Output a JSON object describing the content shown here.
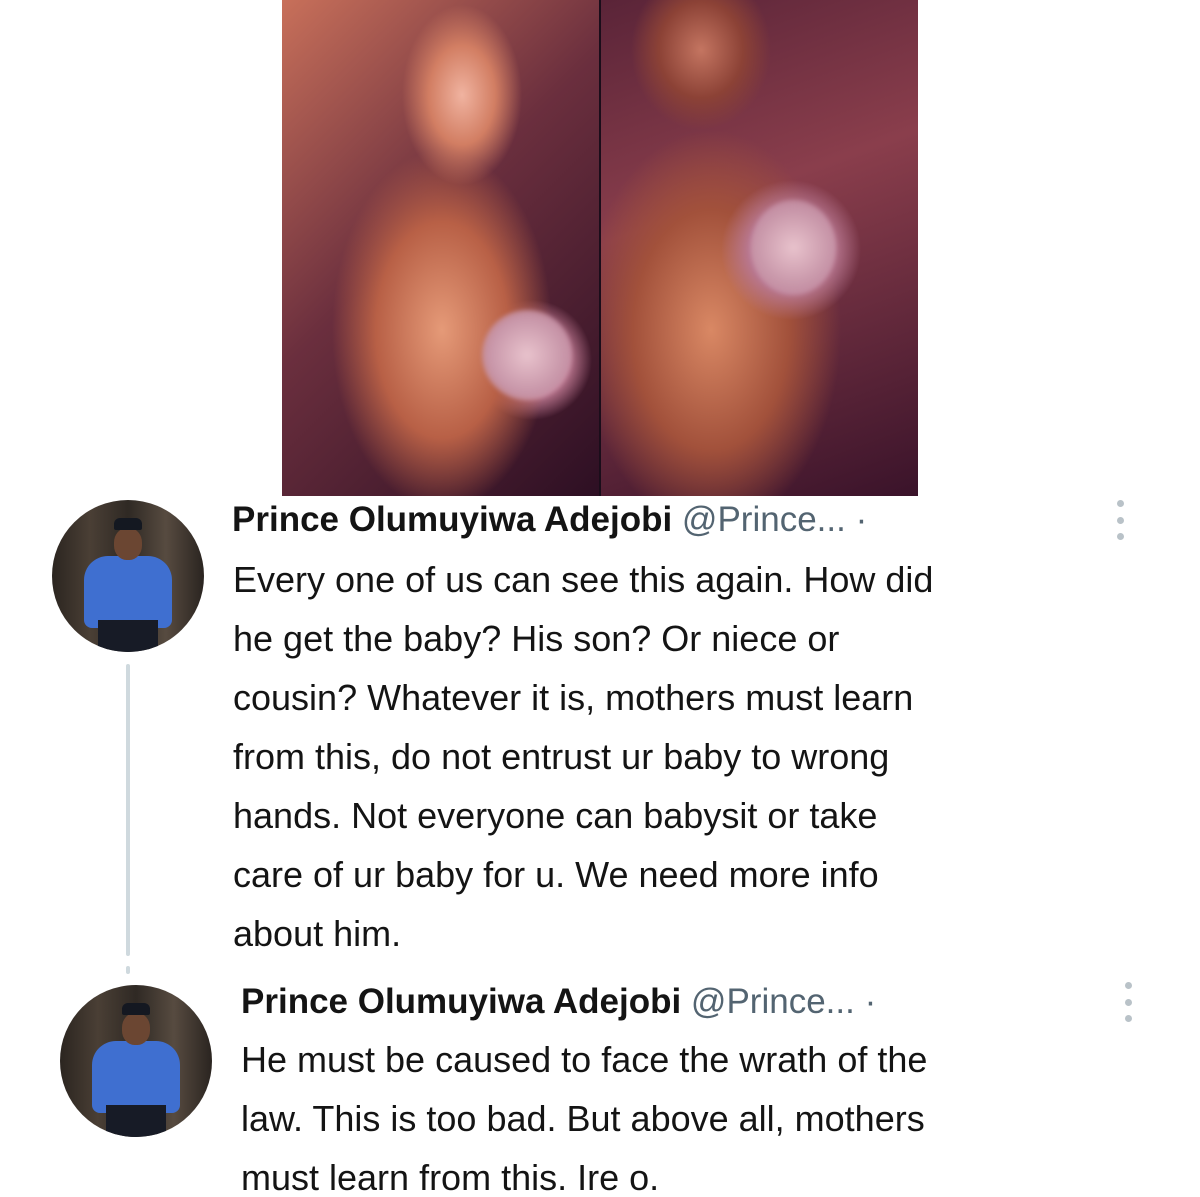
{
  "media": {
    "images": [
      {
        "icon": "photo-man-smoking-with-baby"
      },
      {
        "icon": "photo-man-holding-baby"
      }
    ]
  },
  "tweets": [
    {
      "author": {
        "name": "Prince Olumuyiwa Adejobi",
        "handle": "@Prince...",
        "separator": "·",
        "avatar_icon": "police-officer-avatar"
      },
      "text": "Every one of us can see this again. How did\nhe get the baby? His son? Or niece or\ncousin? Whatever it is, mothers must learn\nfrom this, do not entrust ur baby to wrong\nhands. Not everyone can babysit or take\ncare of ur baby for u. We need more info\nabout him.",
      "more_icon": "more-vertical-icon"
    },
    {
      "author": {
        "name": "Prince Olumuyiwa Adejobi",
        "handle": "@Prince...",
        "separator": "·",
        "avatar_icon": "police-officer-avatar"
      },
      "text": "He must be caused to face the wrath of the\nlaw. This is too bad. But above all, mothers\nmust learn from this. Ire o.",
      "more_icon": "more-vertical-icon"
    }
  ],
  "colors": {
    "text": "#141414",
    "secondary_text": "#536471",
    "thread_line": "#cfd9de",
    "uniform_blue": "#3f6fd0"
  }
}
